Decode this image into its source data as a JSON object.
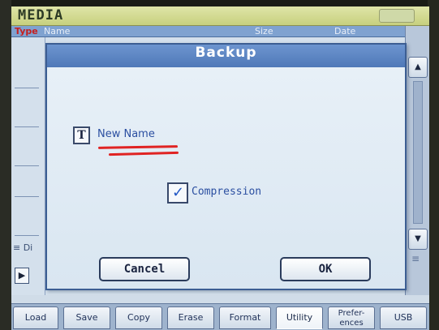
{
  "app": {
    "title": "MEDIA"
  },
  "list": {
    "headers": {
      "type": "Type",
      "name": "Name",
      "size": "Size",
      "date": "Date"
    },
    "left_label": "≡ Di"
  },
  "dialog": {
    "title": "Backup",
    "name_value": "New Name",
    "compression_label": "Compression",
    "compression_checked": true,
    "check_mark": "✓",
    "cancel_label": "Cancel",
    "ok_label": "OK"
  },
  "scroll": {
    "extra": "≡"
  },
  "tabs": [
    {
      "label": "Load",
      "active": false
    },
    {
      "label": "Save",
      "active": false
    },
    {
      "label": "Copy",
      "active": false
    },
    {
      "label": "Erase",
      "active": false
    },
    {
      "label": "Format",
      "active": false
    },
    {
      "label": "Utility",
      "active": true
    },
    {
      "label": "Prefer-\nences",
      "active": false
    },
    {
      "label": "USB",
      "active": false
    }
  ],
  "icons": {
    "text-field": "T",
    "scroll-up": "▲",
    "scroll-down": "▼",
    "play": "▶"
  },
  "colors": {
    "title_bar": "#c7d07e",
    "dialog_title": "#4f79b8",
    "annotation": "#e02323"
  }
}
